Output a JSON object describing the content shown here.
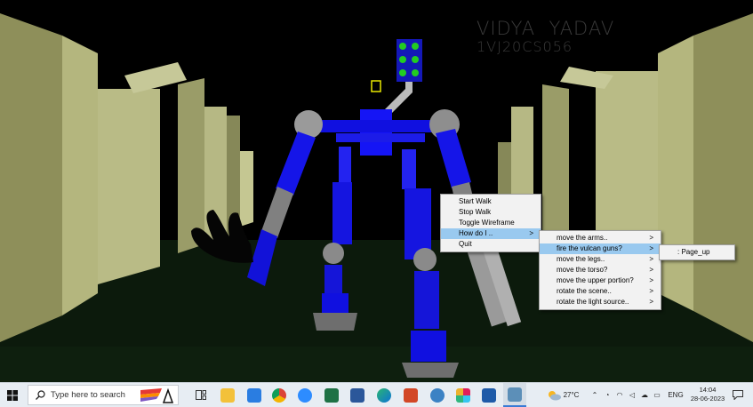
{
  "author": {
    "name": "VIDYA  YADAV",
    "id": "1VJ20CS056"
  },
  "menu": {
    "main": [
      "Start Walk",
      "Stop Walk",
      "Toggle Wireframe",
      "How do I ..",
      "Quit"
    ],
    "main_highlight_index": 3,
    "how_do_i": [
      "move the arms..",
      "fire the vulcan guns?",
      "move the legs..",
      "move the torso?",
      "move the upper portion?",
      "rotate the scene..",
      "rotate the light source.."
    ],
    "how_do_i_highlight_index": 1,
    "answer": ": Page_up",
    "submenu_arrow": ">"
  },
  "taskbar": {
    "search_placeholder": "Type here to search",
    "weather": "27°C",
    "language": "ENG",
    "time": "14:04",
    "date": "28-06-2023",
    "apps": [
      "task-view",
      "file-explorer",
      "store",
      "chrome",
      "zoom",
      "excel",
      "word",
      "edge",
      "powerpoint",
      "chat-app",
      "slack",
      "news-app",
      "control-panel"
    ]
  }
}
